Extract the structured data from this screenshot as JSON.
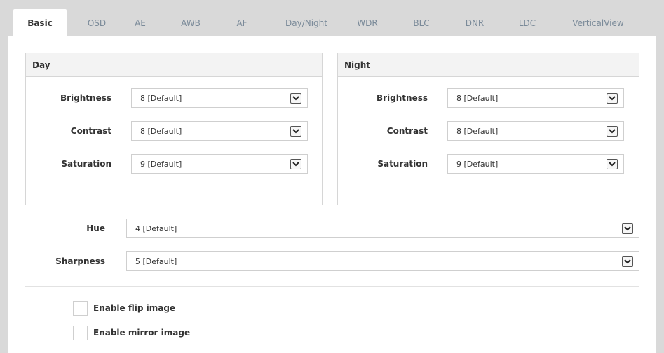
{
  "tabs": [
    {
      "label": "Basic",
      "active": true
    },
    {
      "label": "OSD"
    },
    {
      "label": "AE"
    },
    {
      "label": "AWB"
    },
    {
      "label": "AF"
    },
    {
      "label": "Day/Night"
    },
    {
      "label": "WDR"
    },
    {
      "label": "BLC"
    },
    {
      "label": "DNR"
    },
    {
      "label": "LDC"
    },
    {
      "label": "VerticalView"
    }
  ],
  "day": {
    "title": "Day",
    "brightness": {
      "label": "Brightness",
      "value": "8  [Default]"
    },
    "contrast": {
      "label": "Contrast",
      "value": "8  [Default]"
    },
    "saturation": {
      "label": "Saturation",
      "value": "9  [Default]"
    }
  },
  "night": {
    "title": "Night",
    "brightness": {
      "label": "Brightness",
      "value": "8  [Default]"
    },
    "contrast": {
      "label": "Contrast",
      "value": "8  [Default]"
    },
    "saturation": {
      "label": "Saturation",
      "value": "9  [Default]"
    }
  },
  "hue": {
    "label": "Hue",
    "value": "4  [Default]"
  },
  "sharpness": {
    "label": "Sharpness",
    "value": "5  [Default]"
  },
  "flip": {
    "label": "Enable flip image",
    "checked": false
  },
  "mirror": {
    "label": "Enable mirror image",
    "checked": false
  },
  "icons": {
    "dropdown": "chevron-down-icon"
  }
}
